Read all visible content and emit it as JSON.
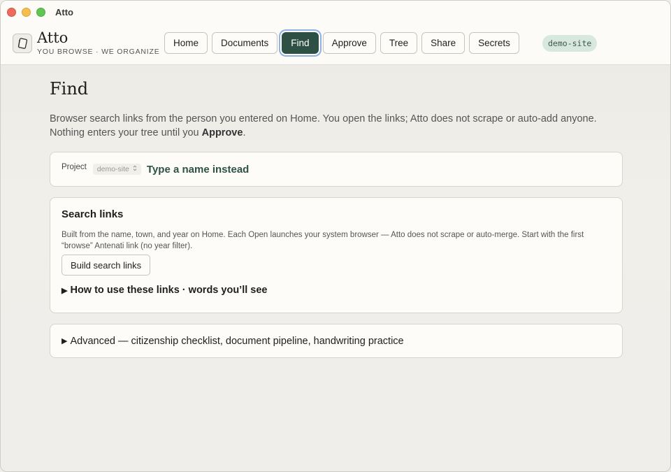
{
  "window": {
    "title": "Atto"
  },
  "brand": {
    "name": "Atto",
    "tagline": "YOU BROWSE · WE ORGANIZE"
  },
  "nav": {
    "items": [
      {
        "label": "Home"
      },
      {
        "label": "Documents"
      },
      {
        "label": "Find"
      },
      {
        "label": "Approve"
      },
      {
        "label": "Tree"
      },
      {
        "label": "Share"
      },
      {
        "label": "Secrets"
      }
    ],
    "active": "Find"
  },
  "site": {
    "badge": "demo-site"
  },
  "page": {
    "title": "Find",
    "intro_part1": "Browser search links from the person you entered on Home. You open the links; Atto does not scrape or auto-add anyone. Nothing enters your tree until you ",
    "intro_bold": "Approve",
    "intro_end": "."
  },
  "project": {
    "label": "Project",
    "selected": "demo-site",
    "type_name_link": "Type a name instead"
  },
  "search_links": {
    "title": "Search links",
    "description": "Built from the name, town, and year on Home. Each Open launches your system browser — Atto does not scrape or auto-merge. Start with the first “browse” Antenati link (no year filter).",
    "build_button": "Build search links",
    "howto_label": "How to use these links · words you’ll see"
  },
  "advanced": {
    "label": "Advanced — citizenship checklist, document pipeline, handwriting practice"
  },
  "icons": {
    "disclosure": "triangle-right-icon",
    "brand": "notebook-icon",
    "select": "updown-chevron-icon"
  },
  "colors": {
    "accent": "#2d4f44",
    "focus_ring": "#8fb1e6",
    "badge_bg": "#d8e8de"
  }
}
